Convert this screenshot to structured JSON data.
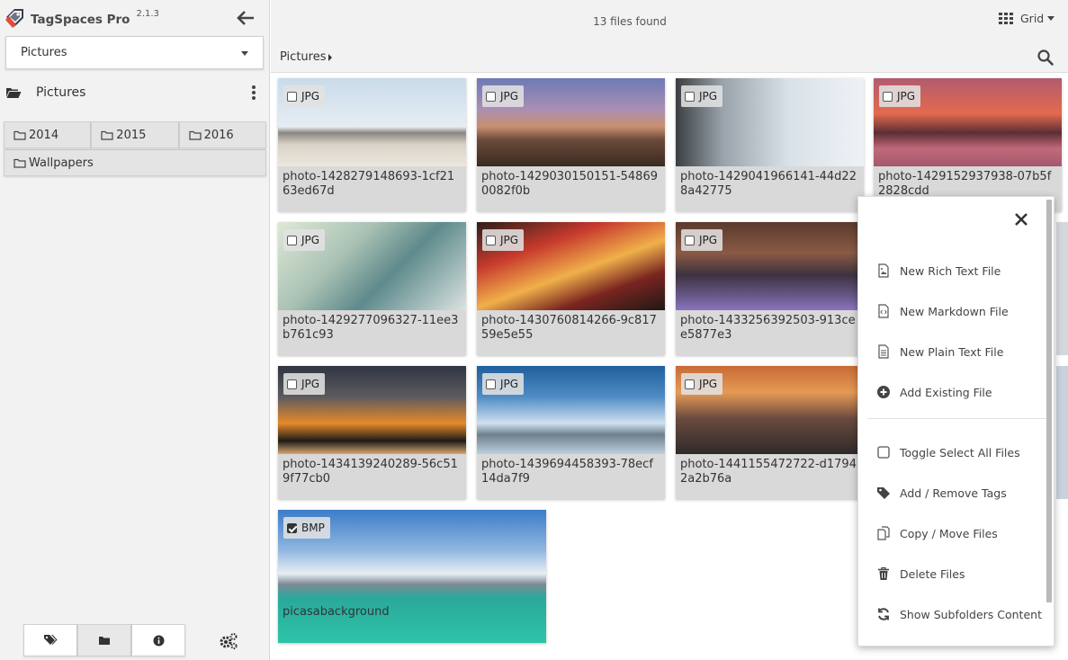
{
  "app": {
    "name": "TagSpaces Pro",
    "version": "2.1.3"
  },
  "location_select": {
    "value": "Pictures"
  },
  "location": {
    "title": "Pictures"
  },
  "subfolders": [
    "2014",
    "2015",
    "2016",
    "Wallpapers"
  ],
  "toolbar": {
    "files_found": "13 files found",
    "view_mode": "Grid"
  },
  "breadcrumb": {
    "current": "Pictures"
  },
  "files": [
    {
      "ext": "JPG",
      "name": "photo-1428279148693-1cf2163ed67d",
      "checked": false
    },
    {
      "ext": "JPG",
      "name": "photo-1429030150151-548690082f0b",
      "checked": false
    },
    {
      "ext": "JPG",
      "name": "photo-1429041966141-44d228a42775",
      "checked": false
    },
    {
      "ext": "JPG",
      "name": "photo-1429152937938-07b5f2828cdd",
      "checked": false
    },
    {
      "ext": "JPG",
      "name": "photo-1429277096327-11ee3b761c93",
      "checked": false
    },
    {
      "ext": "JPG",
      "name": "photo-1430760814266-9c81759e5e55",
      "checked": false
    },
    {
      "ext": "JPG",
      "name": "photo-1433256392503-913cee5877e3",
      "checked": false
    },
    {
      "ext": "JPG",
      "name": "photo-1434139240289-56c519f77cb0",
      "checked": false
    },
    {
      "ext": "JPG",
      "name": "photo-1439694458393-78ecf14da7f9",
      "checked": false
    },
    {
      "ext": "JPG",
      "name": "photo-1441155472722-d17942a2b76a",
      "checked": false
    },
    {
      "ext": "BMP",
      "name": "picasabackground",
      "checked": true
    }
  ],
  "context_menu": {
    "items": [
      {
        "label": "New Rich Text File",
        "icon": "image-file-icon"
      },
      {
        "label": "New Markdown File",
        "icon": "code-file-icon"
      },
      {
        "label": "New Plain Text File",
        "icon": "text-file-icon"
      },
      {
        "label": "Add Existing File",
        "icon": "plus-circle-icon"
      },
      {
        "label": "Toggle Select All Files",
        "icon": "checkbox-icon"
      },
      {
        "label": "Add / Remove Tags",
        "icon": "tag-icon"
      },
      {
        "label": "Copy / Move Files",
        "icon": "copy-icon"
      },
      {
        "label": "Delete Files",
        "icon": "trash-icon"
      },
      {
        "label": "Show Subfolders Content",
        "icon": "refresh-icon"
      }
    ]
  },
  "colors": {
    "sidebar_bg": "#f2f2f2",
    "brand_accent": "#e24a3b",
    "badge_bg": "#e1e1e1"
  }
}
